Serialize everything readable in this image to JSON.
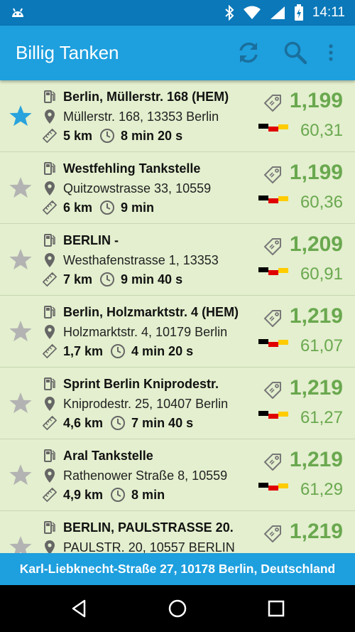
{
  "status_bar": {
    "time": "14:11",
    "icons": [
      "android-icon",
      "bluetooth-icon",
      "wifi-icon",
      "signal-icon",
      "battery-charging-icon"
    ]
  },
  "app_bar": {
    "title": "Billig Tanken",
    "actions": [
      "refresh-icon",
      "search-icon",
      "overflow-menu-icon"
    ]
  },
  "stations": [
    {
      "name": "Berlin, Müllerstr. 168 (HEM)",
      "address": "Müllerstr. 168, 13353 Berlin",
      "distance": "5 km",
      "duration": "8 min 20 s",
      "price": "1,199",
      "total": "60,31",
      "favorite": true
    },
    {
      "name": "Westfehling Tankstelle",
      "address": "Quitzowstrasse 33, 10559",
      "distance": "6 km",
      "duration": "9 min",
      "price": "1,199",
      "total": "60,36",
      "favorite": false
    },
    {
      "name": "BERLIN -",
      "address": "Westhafenstrasse 1, 13353",
      "distance": "7 km",
      "duration": "9 min 40 s",
      "price": "1,209",
      "total": "60,91",
      "favorite": false
    },
    {
      "name": "Berlin, Holzmarktstr. 4 (HEM)",
      "address": "Holzmarktstr. 4, 10179 Berlin",
      "distance": "1,7 km",
      "duration": "4 min 20 s",
      "price": "1,219",
      "total": "61,07",
      "favorite": false
    },
    {
      "name": "Sprint Berlin Kniprodestr.",
      "address": "Kniprodestr. 25, 10407 Berlin",
      "distance": "4,6 km",
      "duration": "7 min 40 s",
      "price": "1,219",
      "total": "61,27",
      "favorite": false
    },
    {
      "name": "Aral Tankstelle",
      "address": "Rathenower Straße 8, 10559",
      "distance": "4,9 km",
      "duration": "8 min",
      "price": "1,219",
      "total": "61,29",
      "favorite": false
    },
    {
      "name": "BERLIN, PAULSTRASSE 20.",
      "address": "PAULSTR. 20, 10557 BERLIN",
      "distance": "",
      "duration": "",
      "price": "1,219",
      "total": "",
      "favorite": false
    }
  ],
  "footer": {
    "location": "Karl-Liebknecht-Straße 27, 10178 Berlin, Deutschland"
  },
  "colors": {
    "status_bar": "#0a78b9",
    "app_bar": "#1e9fde",
    "list_background": "#e3efce",
    "price_green": "#6aa84f",
    "favorite_star": "#29a3dd",
    "default_star": "#b3b3b3"
  },
  "nav_bar": [
    "back-icon",
    "home-icon",
    "recents-icon"
  ]
}
